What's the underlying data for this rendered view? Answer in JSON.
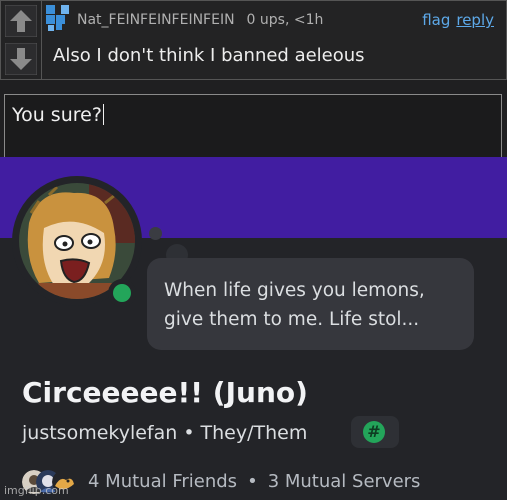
{
  "comment": {
    "username": "Nat_FEINFEINFEINFEIN",
    "meta": "0 ups, <1h",
    "flag_label": "flag",
    "reply_label": "reply",
    "text": "Also I don't think I banned aeleous",
    "icons": [
      "upvote-arrow-icon",
      "downvote-arrow-icon",
      "user-avatar-icon"
    ]
  },
  "reply_box": {
    "value": "You sure?"
  },
  "profile": {
    "banner_color": "#411da1",
    "status_color": "#23a55a",
    "custom_status": "When life gives you lemons, give them to me. Life stol...",
    "display_name": "Circeeeee!! (Juno)",
    "username": "justsomekylefan",
    "separator": "•",
    "pronouns": "They/Them",
    "tag_icon": "#",
    "mutual_friends": "4 Mutual Friends",
    "mutual_dot": "•",
    "mutual_servers": "3 Mutual Servers"
  },
  "watermark": "imgflip.com"
}
